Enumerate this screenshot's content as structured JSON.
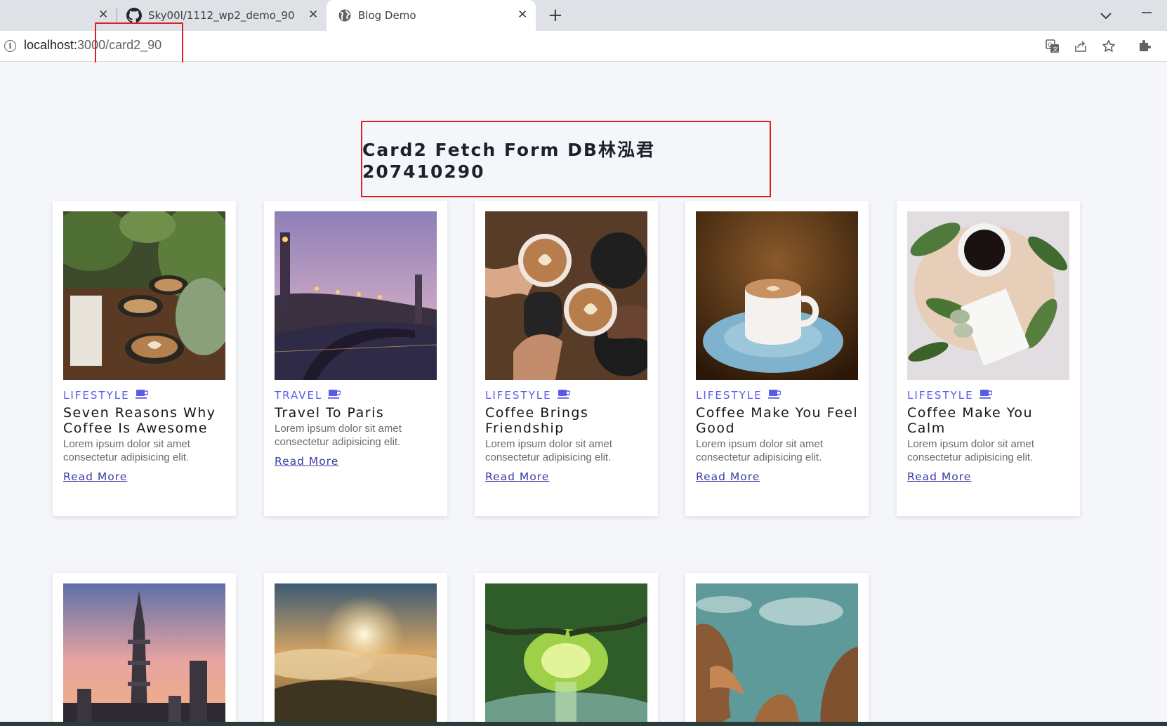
{
  "browser": {
    "tabs": [
      {
        "label": "",
        "active": false
      },
      {
        "label": "Sky00l/1112_wp2_demo_90",
        "icon": "github-icon",
        "active": false
      },
      {
        "label": "Blog Demo",
        "icon": "globe-icon",
        "active": true
      }
    ],
    "new_tab_symbol": "+",
    "close_symbol": "✕",
    "url_host": "localhost:",
    "url_rest": "3000/card2_90",
    "toolbar_icons": [
      "translate-icon",
      "share-icon",
      "star-icon",
      "extensions-icon"
    ]
  },
  "page": {
    "title": "Card2 Fetch Form DB林泓君207410290",
    "read_more_label": "Read More",
    "cards": [
      {
        "category": "LIFESTYLE",
        "title": "Seven Reasons Why Coffee Is Awesome",
        "desc": "Lorem ipsum dolor sit amet consectetur adipisicing elit.",
        "image": "coffee-cups-plants"
      },
      {
        "category": "TRAVEL",
        "title": "Travel To Paris",
        "desc": "Lorem ipsum dolor sit amet consectetur adipisicing elit.",
        "image": "paris-bridge-dusk"
      },
      {
        "category": "LIFESTYLE",
        "title": "Coffee Brings Friendship",
        "desc": "Lorem ipsum dolor sit amet consectetur adipisicing elit.",
        "image": "hands-latte-cheers"
      },
      {
        "category": "LIFESTYLE",
        "title": "Coffee Make You Feel Good",
        "desc": "Lorem ipsum dolor sit amet consectetur adipisicing elit.",
        "image": "blue-saucer-cup"
      },
      {
        "category": "LIFESTYLE",
        "title": "Coffee Make You Calm",
        "desc": "Lorem ipsum dolor sit amet consectetur adipisicing elit.",
        "image": "black-coffee-leaves"
      }
    ],
    "cards_row2": [
      {
        "image": "taipei-101-sunset"
      },
      {
        "image": "mountain-sunrise-clouds"
      },
      {
        "image": "green-tree-tunnel-river"
      },
      {
        "image": "rock-formations-sea"
      }
    ]
  }
}
